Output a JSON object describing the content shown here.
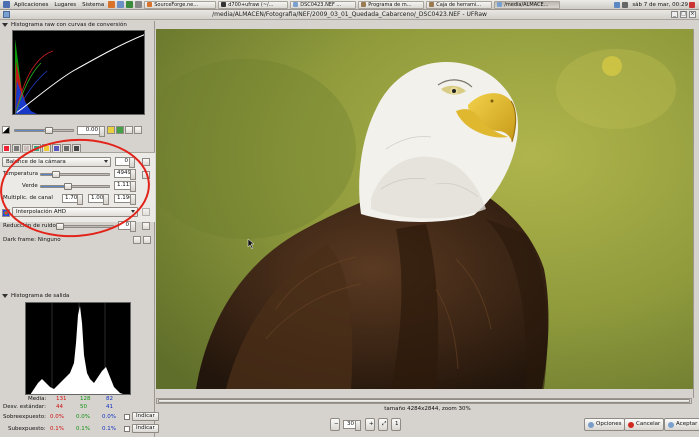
{
  "panel": {
    "menus": [
      "Aplicaciones",
      "Lugares",
      "Sistema"
    ],
    "tasks": [
      {
        "label": "SourceForge.ne..."
      },
      {
        "label": "d700+ufraw (~/..."
      },
      {
        "label": "DSC0423.NEF ..."
      },
      {
        "label": "Programa de m..."
      },
      {
        "label": "Caja de herrami..."
      },
      {
        "label": "/media/ALMACE...",
        "active": true
      }
    ],
    "clock": "sáb  7 de mar,  00:29"
  },
  "window": {
    "title": "/media/ALMACEN/Fotografia/NEF/2009_03_01_Quedada_Cabarceno/_DSC0423.NEF - UFRaw"
  },
  "raw_histogram": {
    "title": "Histograma raw con curvas de conversión"
  },
  "exposure": {
    "value": "0.00"
  },
  "white_balance": {
    "preset": "Balance de la cámara",
    "preset_spin": "0",
    "temperature_label": "Temperatura",
    "temperature": "4949",
    "temperature_level": 0.22,
    "green_label": "Verde",
    "green": "1.115",
    "green_level": 0.38,
    "mult_label": "Multiplic. de canal",
    "mult_r": "1.707",
    "mult_g": "1.000",
    "mult_b": "1.196"
  },
  "interpolation": {
    "value": "Interpolación AHD"
  },
  "noise": {
    "label": "Reducción de ruido",
    "value": "0"
  },
  "dark_frame": {
    "label": "Dark frame:",
    "value": "Ninguno"
  },
  "output_histogram": {
    "title": "Histograma de salida"
  },
  "stats": {
    "media_label": "Media:",
    "media": [
      "131",
      "128",
      "82"
    ],
    "desv_label": "Desv. estándar:",
    "desv": [
      "44",
      "50",
      "41"
    ],
    "sobre_label": "Sobreexpuesto:",
    "sobre": [
      "0.0%",
      "0.0%",
      "0.0%"
    ],
    "sub_label": "Subexpuesto:",
    "sub": [
      "0.1%",
      "0.1%",
      "0.1%"
    ],
    "indicar": "Indicar"
  },
  "image": {
    "size_text": "tamaño 4284x2844, zoom 30%"
  },
  "bottom": {
    "zoom": "30",
    "opciones": "Opciones",
    "cancelar": "Cancelar",
    "aceptar": "Aceptar"
  },
  "colors": {
    "accent": "#5b86c7",
    "highlight_circle": "#e2231a"
  }
}
